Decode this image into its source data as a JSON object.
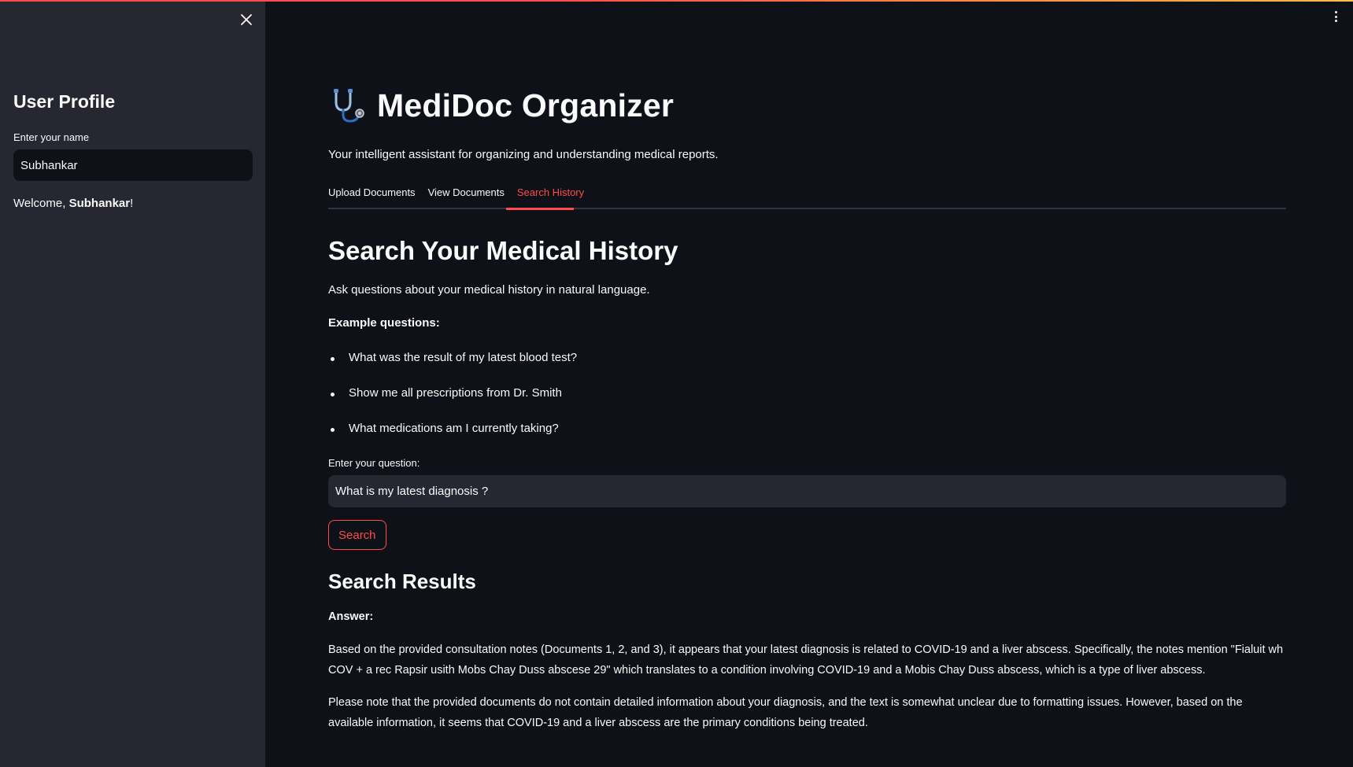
{
  "sidebar": {
    "title": "User Profile",
    "name_label": "Enter your name",
    "name_value": "Subhankar",
    "welcome_prefix": "Welcome, ",
    "welcome_name": "Subhankar",
    "welcome_suffix": "!"
  },
  "header": {
    "app_title": "MediDoc Organizer",
    "subtitle": "Your intelligent assistant for organizing and understanding medical reports."
  },
  "tabs": [
    {
      "label": "Upload Documents",
      "active": false
    },
    {
      "label": "View Documents",
      "active": false
    },
    {
      "label": "Search History",
      "active": true
    }
  ],
  "search": {
    "heading": "Search Your Medical History",
    "intro": "Ask questions about your medical history in natural language.",
    "examples_label": "Example questions:",
    "examples": [
      "What was the result of my latest blood test?",
      "Show me all prescriptions from Dr. Smith",
      "What medications am I currently taking?"
    ],
    "question_label": "Enter your question:",
    "question_value": "What is my latest diagnosis ?",
    "button_label": "Search"
  },
  "results": {
    "heading": "Search Results",
    "answer_label": "Answer:",
    "paragraph_1": "Based on the provided consultation notes (Documents 1, 2, and 3), it appears that your latest diagnosis is related to COVID-19 and a liver abscess. Specifically, the notes mention \"Fialuit wh COV + a rec Rapsir usith Mobs Chay Duss abscese 29\" which translates to a condition involving COVID-19 and a Mobis Chay Duss abscess, which is a type of liver abscess.",
    "paragraph_2": "Please note that the provided documents do not contain detailed information about your diagnosis, and the text is somewhat unclear due to formatting issues. However, based on the available information, it seems that COVID-19 and a liver abscess are the primary conditions being treated."
  },
  "icons": {
    "close": "close-icon",
    "menu": "kebab-menu-icon",
    "logo": "stethoscope-icon"
  },
  "colors": {
    "background": "#0e1117",
    "sidebar": "#262730",
    "accent": "#ff4b4b",
    "text": "#fafafa"
  }
}
